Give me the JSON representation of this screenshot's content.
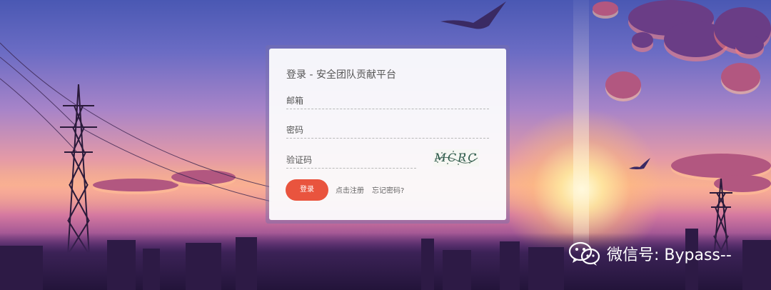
{
  "login": {
    "title": "登录 - 安全团队贡献平台",
    "email_label": "邮箱",
    "password_label": "密码",
    "captcha_label": "验证码",
    "captcha_text": "MCRC",
    "login_button": "登录",
    "register_link": "点击注册",
    "forgot_link": "忘记密码?"
  },
  "watermark": {
    "text": "微信号: Bypass--",
    "icon": "wechat-icon"
  },
  "colors": {
    "accent": "#e9543e"
  }
}
